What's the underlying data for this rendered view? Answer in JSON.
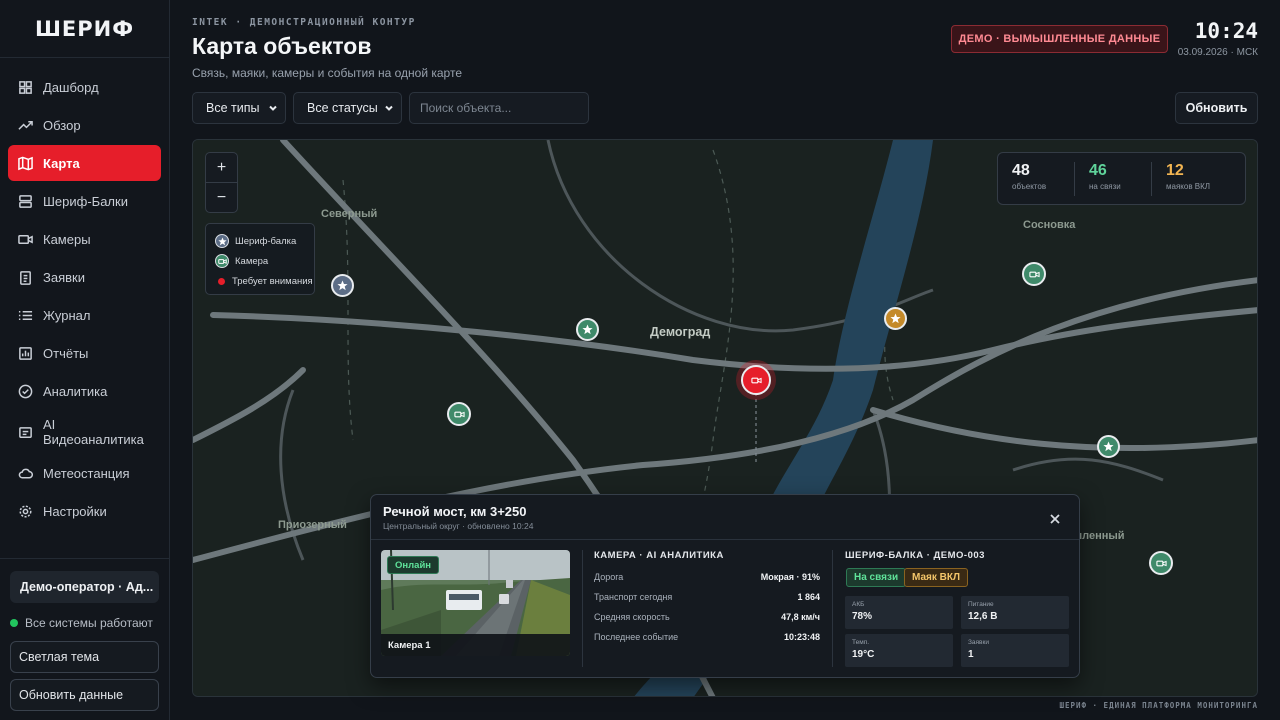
{
  "app": {
    "logo": "ШЕРИФ"
  },
  "sidebar": {
    "items": [
      {
        "label": "Дашборд",
        "icon": "grid-icon"
      },
      {
        "label": "Обзор",
        "icon": "trend-icon"
      },
      {
        "label": "Карта",
        "icon": "map-icon",
        "active": true
      },
      {
        "label": "Шериф-Балки",
        "icon": "server-icon"
      },
      {
        "label": "Камеры",
        "icon": "camera-icon"
      },
      {
        "label": "Заявки",
        "icon": "clipboard-icon"
      },
      {
        "label": "Журнал",
        "icon": "list-icon"
      },
      {
        "label": "Отчёты",
        "icon": "bar-chart-icon"
      },
      {
        "label": "Аналитика",
        "icon": "check-circle-icon"
      },
      {
        "label": "AI\nВидеоаналитика",
        "icon": "ai-video-icon"
      },
      {
        "label": "Метеостанция",
        "icon": "cloud-icon"
      },
      {
        "label": "Настройки",
        "icon": "gear-icon"
      }
    ],
    "user": "Демо-оператор · Ад...",
    "status": "Все системы работают",
    "theme_button": "Светлая тема",
    "refresh_button": "Обновить данные"
  },
  "header": {
    "kicker": "INTEK · ДЕМОНСТРАЦИОННЫЙ КОНТУР",
    "title": "Карта объектов",
    "subtitle": "Связь, маяки, камеры и события на одной карте",
    "demo_badge": "ДЕМО · ВЫМЫШЛЕННЫЕ ДАННЫЕ",
    "time": "10:24",
    "date": "03.09.2026 · МСК"
  },
  "toolbar": {
    "type_filter": "Все типы",
    "status_filter": "Все статусы",
    "search_placeholder": "Поиск объекта...",
    "refresh": "Обновить"
  },
  "map": {
    "places": {
      "severny": "Северный",
      "sosnovka": "Сосновка",
      "demograd": "Демоград",
      "priozerny": "Приозерный",
      "promyshlenny": "шленный"
    },
    "zoom_in": "+",
    "zoom_out": "−",
    "legend": {
      "balka": "Шериф-балка",
      "camera": "Камера",
      "attention": "Требует внимания"
    },
    "stats": [
      {
        "value": "48",
        "label": "объектов",
        "color": "#f1f3f5"
      },
      {
        "value": "46",
        "label": "на связи",
        "color": "#5fd39a"
      },
      {
        "value": "12",
        "label": "маяков ВКЛ",
        "color": "#f2b552"
      }
    ]
  },
  "popup": {
    "title": "Речной мост, км 3+250",
    "subtitle": "Центральный округ · обновлено 10:24",
    "camera_badge": "Онлайн",
    "camera_caption": "Камера 1",
    "camera_section": {
      "title": "КАМЕРА · AI АНАЛИТИКА",
      "rows": [
        {
          "k": "Дорога",
          "v": "Мокрая · 91%"
        },
        {
          "k": "Транспорт сегодня",
          "v": "1 864"
        },
        {
          "k": "Средняя скорость",
          "v": "47,8 км/ч"
        },
        {
          "k": "Последнее событие",
          "v": "10:23:48"
        }
      ]
    },
    "balka_section": {
      "title": "ШЕРИФ-БАЛКА · ДЕМО-003",
      "tag_online": "На связи",
      "tag_beacon": "Маяк ВКЛ",
      "cells": [
        {
          "k": "АКБ",
          "v": "78%"
        },
        {
          "k": "Питание",
          "v": "12,6 В"
        },
        {
          "k": "Темп.",
          "v": "19°C"
        },
        {
          "k": "Заявки",
          "v": "1"
        }
      ]
    }
  },
  "footer": "ШЕРИФ · ЕДИНАЯ ПЛАТФОРМА МОНИТОРИНГА",
  "colors": {
    "accent": "#e61e2a",
    "online": "#5fe39a",
    "beacon": "#f2b552"
  }
}
